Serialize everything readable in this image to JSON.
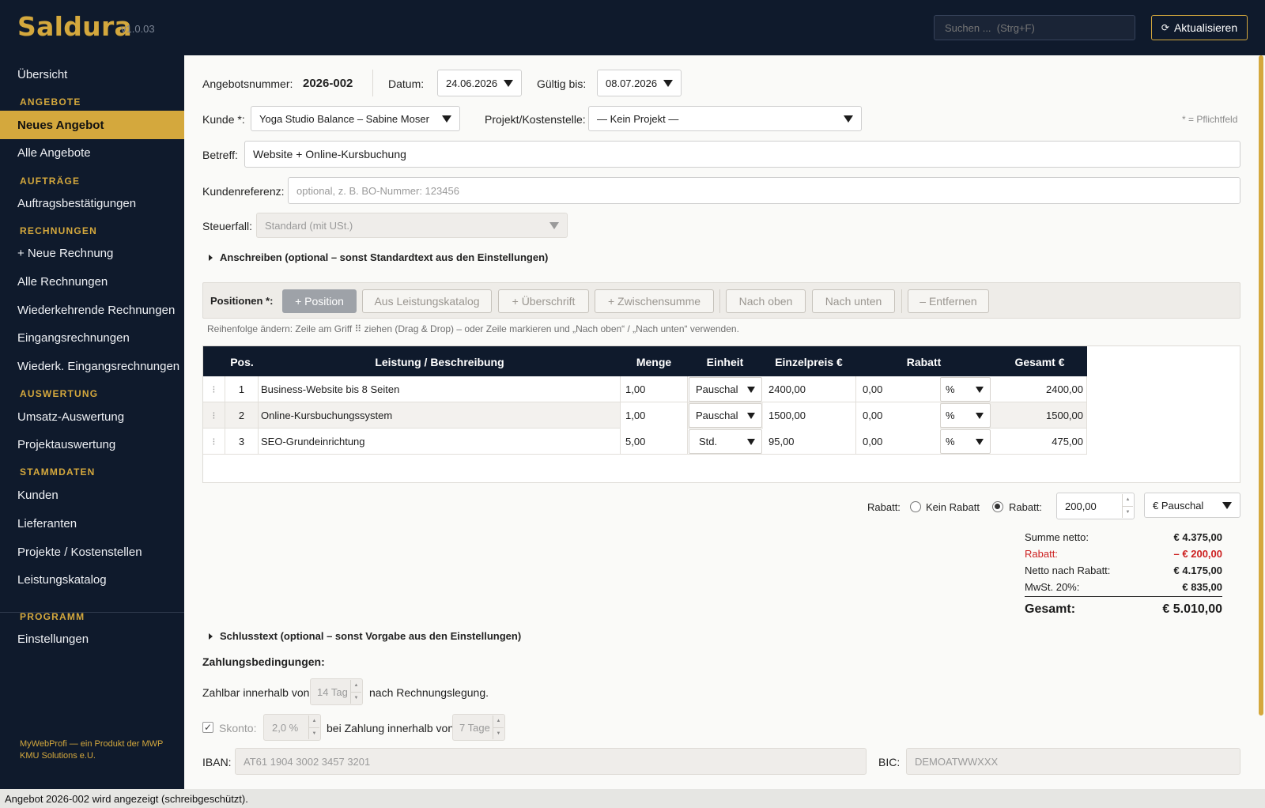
{
  "app": {
    "name": "Saldura",
    "version": "v1.0.03"
  },
  "topbar": {
    "search_placeholder": "Suchen ...  (Strg+F)",
    "refresh_label": "Aktualisieren",
    "refresh_icon": "refresh-icon"
  },
  "sidebar": {
    "overview": "Übersicht",
    "sections": {
      "angebote": "ANGEBOTE",
      "auftraege": "AUFTRÄGE",
      "rechnungen": "RECHNUNGEN",
      "auswertung": "AUSWERTUNG",
      "stammdaten": "STAMMDATEN",
      "programm": "PROGRAMM"
    },
    "items": {
      "neues_angebot": "Neues Angebot",
      "alle_angebote": "Alle Angebote",
      "auftragsbestaetigungen": "Auftragsbestätigungen",
      "neue_rechnung": "+ Neue Rechnung",
      "alle_rechnungen": "Alle Rechnungen",
      "wiederkehrende": "Wiederkehrende Rechnungen",
      "eingangsrechnungen": "Eingangsrechnungen",
      "wiederk_eingangs": "Wiederk. Eingangsrechnungen",
      "umsatz": "Umsatz-Auswertung",
      "projektauswertung": "Projektauswertung",
      "kunden": "Kunden",
      "lieferanten": "Lieferanten",
      "projekte": "Projekte / Kostenstellen",
      "leistungskatalog": "Leistungskatalog",
      "einstellungen": "Einstellungen"
    },
    "footer": "MyWebProfi — ein Produkt der MWP KMU Solutions e.U."
  },
  "form": {
    "angebotsnummer_label": "Angebotsnummer:",
    "angebotsnummer": "2026-002",
    "datum_label": "Datum:",
    "datum": "24.06.2026",
    "gueltig_label": "Gültig bis:",
    "gueltig": "08.07.2026",
    "kunde_label": "Kunde *:",
    "kunde": "Yoga Studio Balance – Sabine Moser",
    "projekt_label": "Projekt/Kostenstelle:",
    "projekt": "— Kein Projekt —",
    "pflichtfeld": "* = Pflichtfeld",
    "betreff_label": "Betreff:",
    "betreff": "Website + Online-Kursbuchung",
    "kundenreferenz_label": "Kundenreferenz:",
    "kundenreferenz_placeholder": "optional, z. B. BO-Nummer: 123456",
    "steuerfall_label": "Steuerfall:",
    "steuerfall": "Standard (mit USt.)",
    "anschreiben": "Anschreiben (optional – sonst Standardtext aus den Einstellungen)"
  },
  "positions": {
    "label": "Positionen *:",
    "buttons": {
      "add": "+ Position",
      "katalog": "Aus Leistungskatalog",
      "ueberschrift": "+ Überschrift",
      "zwischensumme": "+ Zwischensumme",
      "nach_oben": "Nach oben",
      "nach_unten": "Nach unten",
      "entfernen": "– Entfernen"
    },
    "hint": "Reihenfolge ändern: Zeile am Griff ⠿ ziehen (Drag & Drop) – oder Zeile markieren und „Nach oben“ / „Nach unten“ verwenden.",
    "columns": [
      "Pos.",
      "Leistung / Beschreibung",
      "Menge",
      "Einheit",
      "Einzelpreis €",
      "Rabatt",
      "Gesamt €"
    ],
    "rows": [
      {
        "handle": "⁝",
        "pos": "1",
        "desc": "Business-Website bis 8 Seiten",
        "menge": "1,00",
        "einheit": "Pauschal",
        "preis": "2400,00",
        "rabatt": "0,00",
        "rabatt_typ": "%",
        "gesamt": "2400,00"
      },
      {
        "handle": "⁝",
        "pos": "2",
        "desc": "Online-Kursbuchungssystem",
        "menge": "1,00",
        "einheit": "Pauschal",
        "preis": "1500,00",
        "rabatt": "0,00",
        "rabatt_typ": "%",
        "gesamt": "1500,00"
      },
      {
        "handle": "⁝",
        "pos": "3",
        "desc": "SEO-Grundeinrichtung",
        "menge": "5,00",
        "einheit": "Std.",
        "preis": "95,00",
        "rabatt": "0,00",
        "rabatt_typ": "%",
        "gesamt": "475,00"
      }
    ]
  },
  "rabatt": {
    "label": "Rabatt:",
    "kein_rabatt": "Kein Rabatt",
    "rabatt_option": "Rabatt:",
    "value": "200,00",
    "typ": "€ Pauschal"
  },
  "summary": {
    "summe_netto_label": "Summe netto:",
    "summe_netto": "€ 4.375,00",
    "rabatt_label": "Rabatt:",
    "rabatt": "– € 200,00",
    "netto_nach_label": "Netto nach Rabatt:",
    "netto_nach": "€ 4.175,00",
    "mwst_label": "MwSt. 20%:",
    "mwst": "€ 835,00",
    "gesamt_label": "Gesamt:",
    "gesamt": "€ 5.010,00"
  },
  "schluss": {
    "schlusstext": "Schlusstext (optional – sonst Vorgabe aus den Einstellungen)",
    "zahlungsbedingungen": "Zahlungsbedingungen:",
    "zahlbar_label": "Zahlbar innerhalb von",
    "zahlbar_value": "14 Tag",
    "zahlbar_suffix": "nach Rechnungslegung.",
    "skonto_label": "Skonto:",
    "skonto_value": "2,0 %",
    "skonto_mid": "bei Zahlung innerhalb von",
    "skonto_tage": "7 Tage",
    "iban_label": "IBAN:",
    "iban": "AT61 1904 3002 3457 3201",
    "bic_label": "BIC:",
    "bic": "DEMOATWWXXX"
  },
  "status": "Angebot 2026-002 wird angezeigt (schreibgeschützt).",
  "colors": {
    "accent": "#d4a83d",
    "navy": "#0f1a2c",
    "danger": "#cc1f1f"
  }
}
